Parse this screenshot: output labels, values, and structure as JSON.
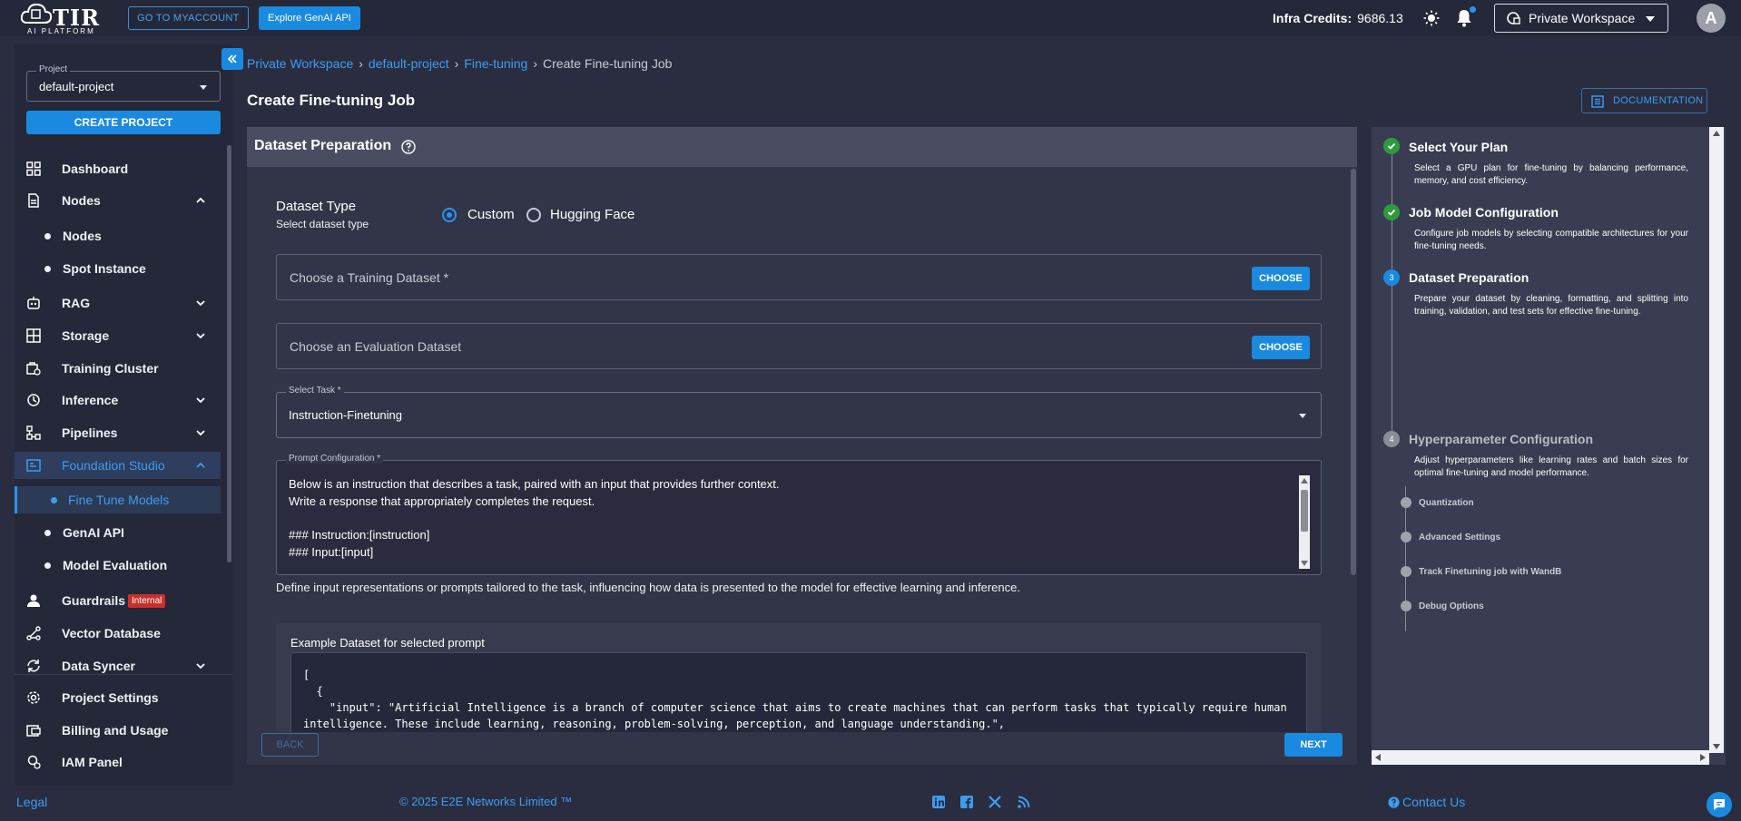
{
  "topbar": {
    "logo_text": "TIR",
    "logo_sub": "AI PLATFORM",
    "my_account_label": "GO TO MYACCOUNT",
    "genai_label": "Explore GenAI API",
    "credits_label": "Infra Credits:",
    "credits_value": "9686.13",
    "workspace_label": "Private Workspace",
    "avatar_letter": "A"
  },
  "sidebar": {
    "project_label": "Project",
    "project_value": "default-project",
    "create_project_label": "CREATE PROJECT",
    "items": {
      "dashboard": "Dashboard",
      "nodes": "Nodes",
      "nodes_sub": "Nodes",
      "spot": "Spot Instance",
      "rag": "RAG",
      "storage": "Storage",
      "training_cluster": "Training Cluster",
      "inference": "Inference",
      "pipelines": "Pipelines",
      "foundation_studio": "Foundation Studio",
      "fine_tune_models": "Fine Tune Models",
      "genai_api": "GenAI API",
      "model_evaluation": "Model Evaluation",
      "guardrails": "Guardrails",
      "guardrails_badge": "Internal",
      "vector_db": "Vector Database",
      "data_syncer": "Data Syncer",
      "project_settings": "Project Settings",
      "billing": "Billing and Usage",
      "iam": "IAM Panel"
    }
  },
  "breadcrumb": {
    "b1": "Private Workspace",
    "b2": "default-project",
    "b3": "Fine-tuning",
    "current": "Create Fine-tuning Job"
  },
  "page": {
    "title": "Create Fine-tuning Job",
    "documentation_label": "DOCUMENTATION"
  },
  "form": {
    "section_title": "Dataset Preparation",
    "dataset_type_label": "Dataset Type",
    "dataset_type_sub": "Select dataset type",
    "radio_custom": "Custom",
    "radio_hf": "Hugging Face",
    "training_placeholder": "Choose a Training Dataset *",
    "evaluation_placeholder": "Choose an Evaluation Dataset",
    "choose_label": "CHOOSE",
    "task_label": "Select Task *",
    "task_value": "Instruction-Finetuning",
    "prompt_label": "Prompt Configuration *",
    "prompt_lines": [
      "Below is an instruction that describes a task, paired with an input that provides further context.",
      "Write a response that appropriately completes the request.",
      "### Instruction:[instruction]",
      "### Input:[input]"
    ],
    "prompt_help": "Define input representations or prompts tailored to the task, influencing how data is presented to the model for effective learning and inference.",
    "example_title": "Example Dataset for selected prompt",
    "example_lines": [
      "[",
      "  {",
      "    \"input\": \"Artificial Intelligence is a branch of computer science that aims to create machines that can perform tasks that typically require human",
      "intelligence. These include learning, reasoning, problem-solving, perception, and language understanding.\","
    ],
    "back_label": "BACK",
    "next_label": "NEXT"
  },
  "stepper": {
    "steps": [
      {
        "title": "Select Your Plan",
        "desc": "Select a GPU plan for fine-tuning by balancing performance, memory, and cost efficiency.",
        "status": "done"
      },
      {
        "title": "Job Model Configuration",
        "desc": "Configure job models by selecting compatible architectures for your fine-tuning needs.",
        "status": "done"
      },
      {
        "title": "Dataset Preparation",
        "desc": "Prepare your dataset by cleaning, formatting, and splitting into training, validation, and test sets for effective fine-tuning.",
        "status": "current",
        "number": "3"
      },
      {
        "title": "Hyperparameter Configuration",
        "desc": "Adjust hyperparameters like learning rates and batch sizes for optimal fine-tuning and model performance.",
        "status": "todo",
        "number": "4"
      }
    ],
    "sub_steps": [
      "Quantization",
      "Advanced Settings",
      "Track Finetuning job with WandB",
      "Debug Options"
    ]
  },
  "footer": {
    "legal": "Legal",
    "copyright": "© 2025 E2E Networks Limited ™",
    "contact": "Contact Us"
  },
  "colors": {
    "accent": "#1a8ae0",
    "done": "#2e9a3e",
    "badge": "#c9302c"
  }
}
